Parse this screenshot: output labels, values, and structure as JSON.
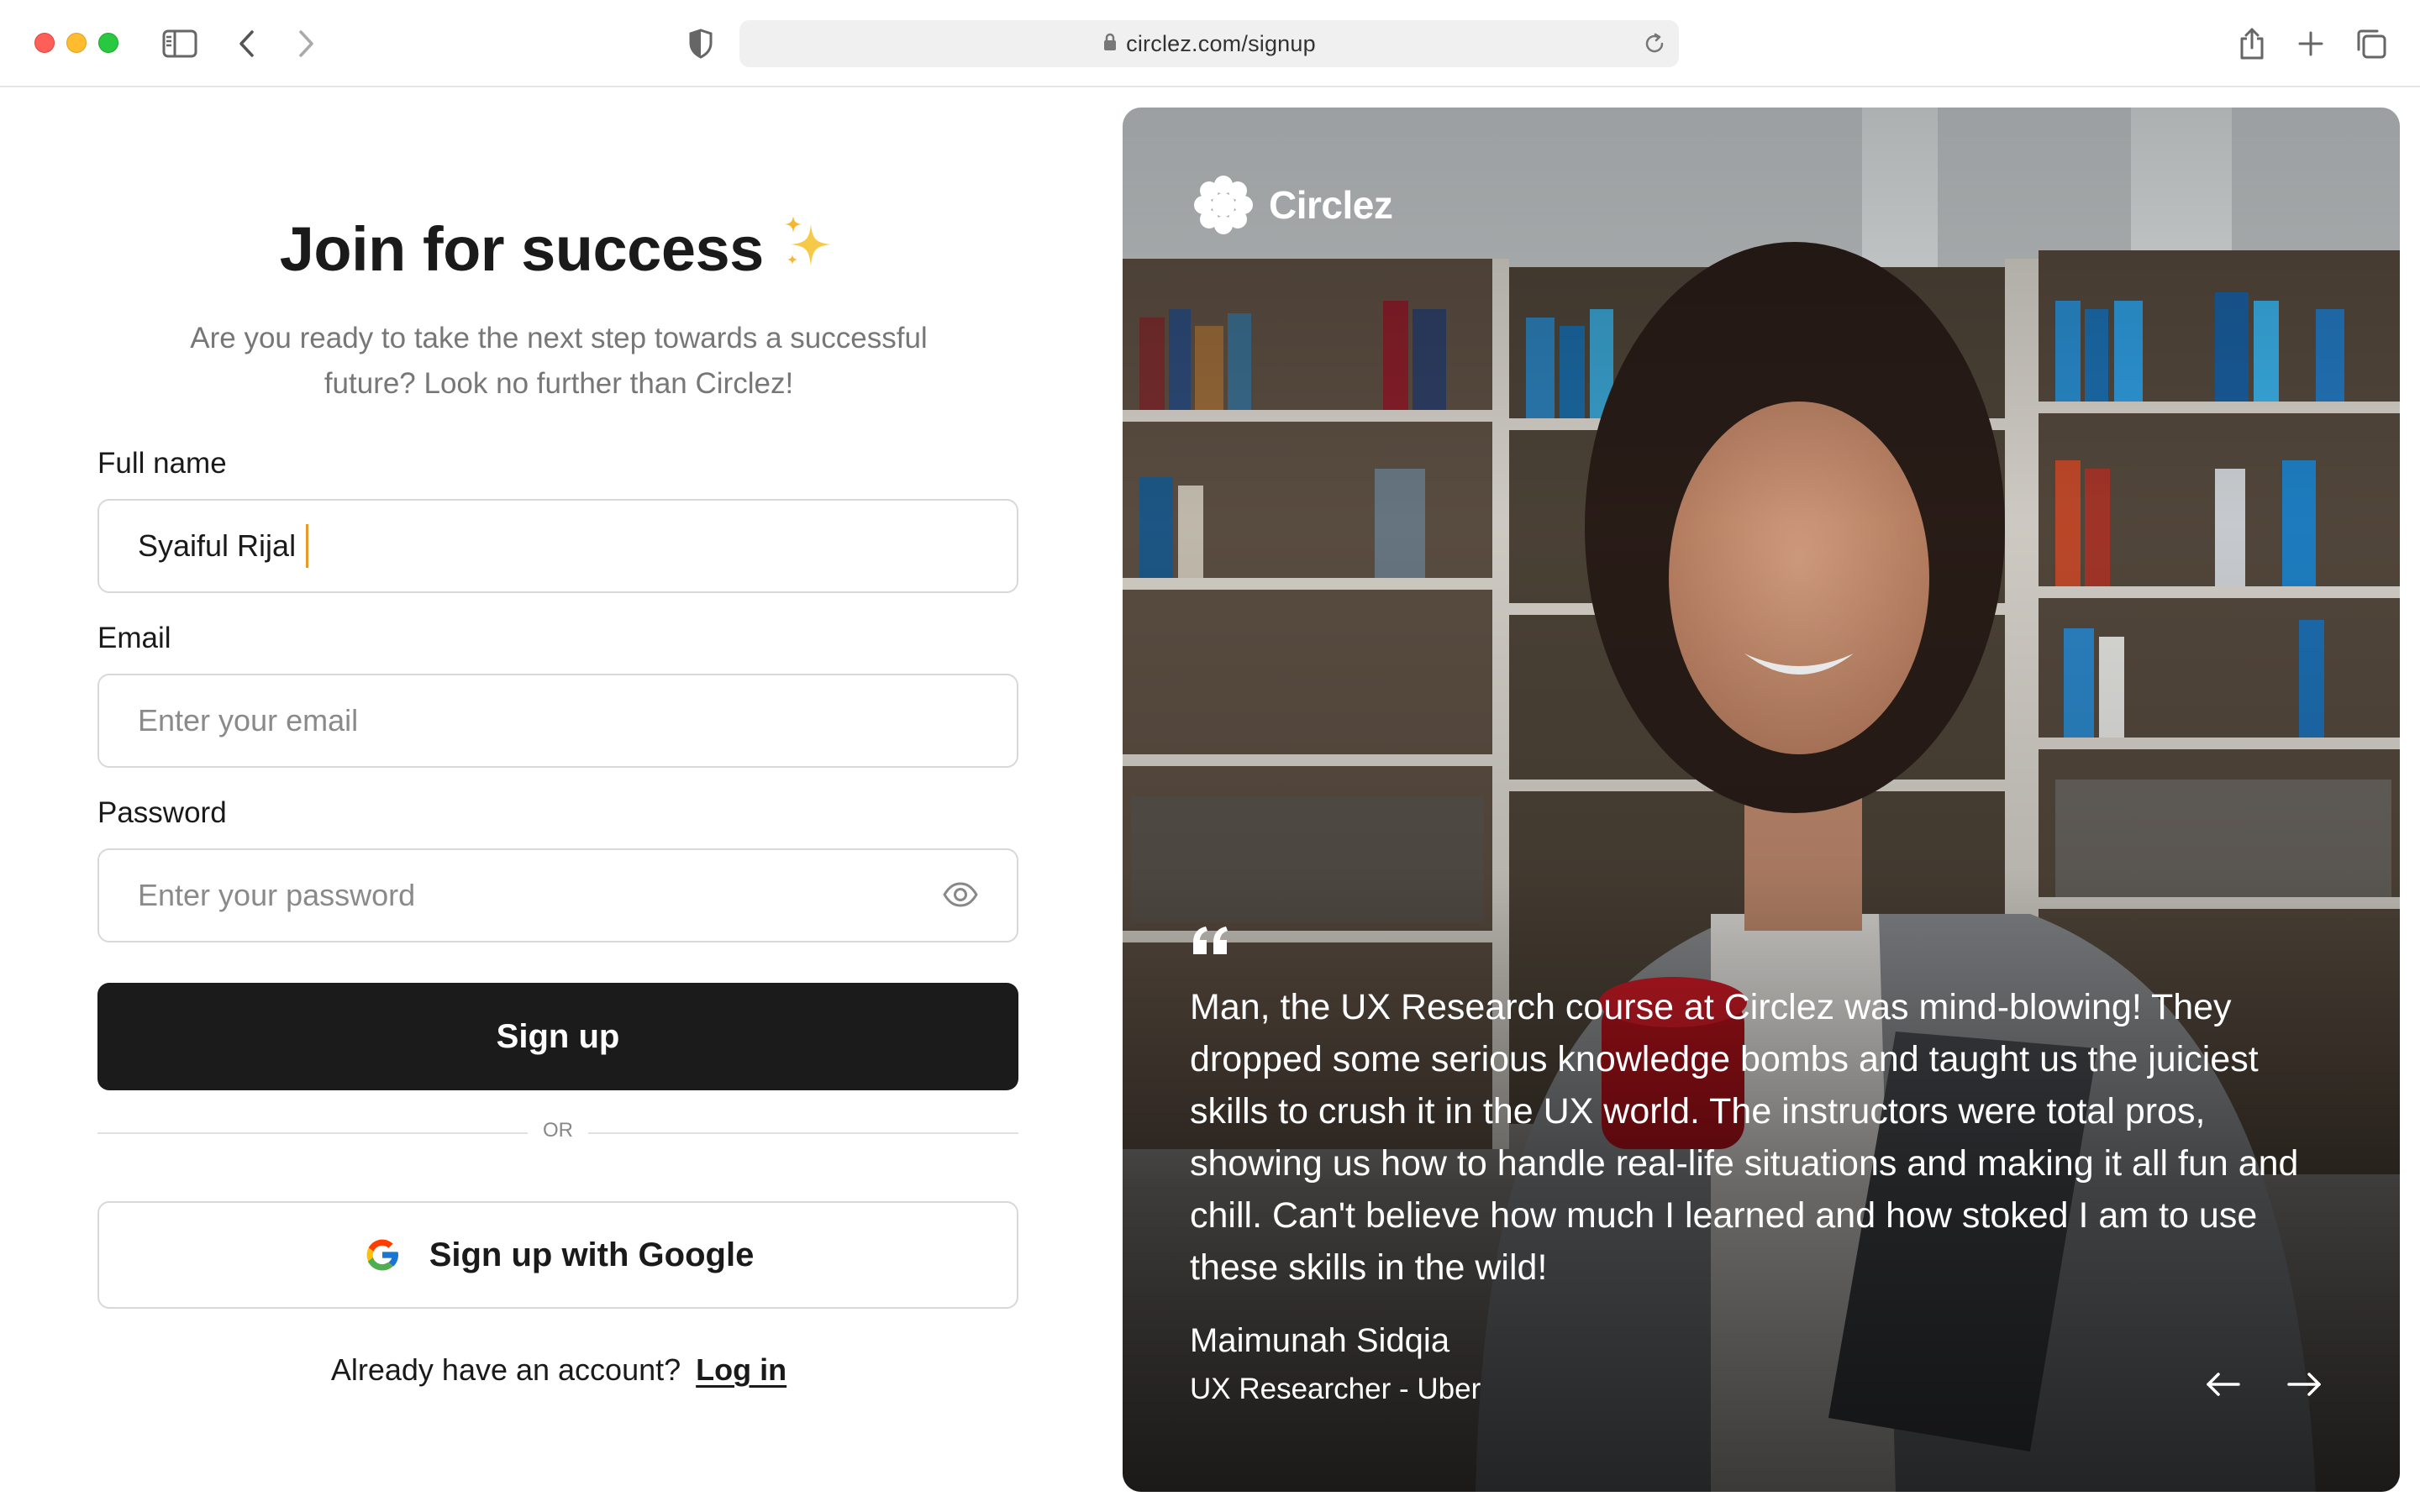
{
  "browser": {
    "url": "circlez.com/signup"
  },
  "signup": {
    "title": "Join for success",
    "subtitle": "Are you ready to take the next step towards a successful future? Look no further than Circlez!",
    "full_name_label": "Full name",
    "full_name_value": "Syaiful Rijal",
    "email_label": "Email",
    "email_placeholder": "Enter your email",
    "password_label": "Password",
    "password_placeholder": "Enter your password",
    "signup_button": "Sign up",
    "divider_text": "OR",
    "google_button": "Sign up with Google",
    "login_prompt": "Already have an account?",
    "login_link": "Log in"
  },
  "hero": {
    "brand": "Circlez",
    "testimonial": "Man, the UX Research course at Circlez was mind-blowing! They dropped some serious knowledge bombs and taught us the juiciest skills to crush it in the UX world. The instructors were total pros, showing us how to handle real-life situations and making it all fun and chill. Can't believe how much I learned and how stoked I am to use these skills in the wild!",
    "author_name": "Maimunah Sidqia",
    "author_role": "UX Researcher - Uber"
  },
  "icons": {
    "sidebar": "sidebar-icon",
    "back": "chevron-left-icon",
    "forward": "chevron-right-icon",
    "privacy": "shield-icon",
    "lock": "lock-icon",
    "reload": "reload-icon",
    "share": "share-icon",
    "new_tab": "plus-icon",
    "tabs": "tabs-icon",
    "sparkle": "sparkle-icon",
    "eye": "eye-icon",
    "google": "google-icon",
    "quote": "quote-icon",
    "prev": "arrow-left-icon",
    "next": "arrow-right-icon"
  },
  "colors": {
    "primary_button": "#1b1b1b",
    "caret": "#e79a2a",
    "sparkle": "#f5c542"
  }
}
